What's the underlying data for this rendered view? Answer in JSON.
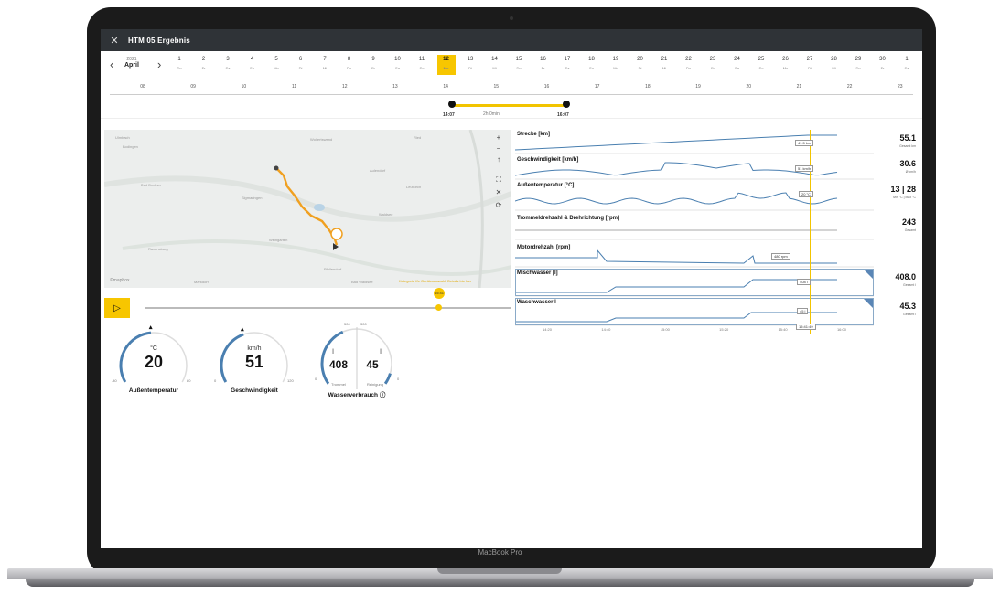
{
  "window": {
    "title": "HTM 05 Ergebnis"
  },
  "calendar": {
    "year": "2021",
    "month": "April",
    "days": [
      {
        "num": "1",
        "wd": "Do"
      },
      {
        "num": "2",
        "wd": "Fr"
      },
      {
        "num": "3",
        "wd": "Sa"
      },
      {
        "num": "4",
        "wd": "So"
      },
      {
        "num": "5",
        "wd": "Mo"
      },
      {
        "num": "6",
        "wd": "Di"
      },
      {
        "num": "7",
        "wd": "Mi"
      },
      {
        "num": "8",
        "wd": "Do"
      },
      {
        "num": "9",
        "wd": "Fr"
      },
      {
        "num": "10",
        "wd": "Sa"
      },
      {
        "num": "11",
        "wd": "So"
      },
      {
        "num": "12",
        "wd": "Mo"
      },
      {
        "num": "13",
        "wd": "Di"
      },
      {
        "num": "14",
        "wd": "Mi"
      },
      {
        "num": "15",
        "wd": "Do"
      },
      {
        "num": "16",
        "wd": "Fr"
      },
      {
        "num": "17",
        "wd": "Sa"
      },
      {
        "num": "18",
        "wd": "So"
      },
      {
        "num": "19",
        "wd": "Mo"
      },
      {
        "num": "20",
        "wd": "Di"
      },
      {
        "num": "21",
        "wd": "Mi"
      },
      {
        "num": "22",
        "wd": "Do"
      },
      {
        "num": "23",
        "wd": "Fr"
      },
      {
        "num": "24",
        "wd": "Sa"
      },
      {
        "num": "25",
        "wd": "So"
      },
      {
        "num": "26",
        "wd": "Mo"
      },
      {
        "num": "27",
        "wd": "Di"
      },
      {
        "num": "28",
        "wd": "Mi"
      },
      {
        "num": "29",
        "wd": "Do"
      },
      {
        "num": "30",
        "wd": "Fr"
      },
      {
        "num": "1",
        "wd": "Sa"
      }
    ],
    "active_index": 11
  },
  "timeline": {
    "ticks": [
      "08",
      "09",
      "10",
      "11",
      "12",
      "13",
      "14",
      "15",
      "16",
      "17",
      "18",
      "19",
      "20",
      "21",
      "22",
      "23"
    ],
    "start": "14:07",
    "end": "16:07",
    "duration": "2h 0min"
  },
  "map": {
    "places": [
      "Ulmbach",
      "Bodingen",
      "Wolfertswend",
      "Ried",
      "Bad Buchau",
      "Sigmaringen",
      "Leutkirch",
      "Aulendorf",
      "Waldsee",
      "Ravensburg",
      "Weingarten",
      "Markdorf",
      "Pfullendorf",
      "Bad Waldsee"
    ],
    "attribution": "©mapbox",
    "note": "Kategorie für Geräteauswahl: Details bis hier",
    "controls": [
      "+",
      "−",
      "↑"
    ]
  },
  "playback": {
    "play_symbol": "▷",
    "time_marker": "15:41"
  },
  "gauges": {
    "temperature": {
      "unit": "°C",
      "value": "20",
      "label": "Außentemperatur",
      "min": "-40",
      "max": "80",
      "fraction": 0.48
    },
    "speed": {
      "unit": "km/h",
      "value": "51",
      "label": "Geschwindigkeit",
      "min": "0",
      "max": "120",
      "fraction": 0.42
    },
    "water": {
      "label": "Wasserverbrauch",
      "left": {
        "unit": "l",
        "value": "408",
        "sub": "Trommel",
        "scale": "500",
        "min": "0",
        "fraction": 0.81
      },
      "right": {
        "unit": "l",
        "value": "45",
        "sub": "Reinigung",
        "scale": "300",
        "min": "0",
        "fraction": 0.15
      }
    }
  },
  "charts": {
    "rows": [
      {
        "title": "Strecke [km]",
        "value": "55.1",
        "sub": "Gesamt km",
        "box": "41.5 km"
      },
      {
        "title": "Geschwindigkeit [km/h]",
        "value": "30.6",
        "sub": "Ø km/h",
        "box": "51 km/h"
      },
      {
        "title": "Außentemperatur [°C]",
        "value": "13 | 28",
        "sub": "Min °C | Max °C",
        "box": "20 °C"
      },
      {
        "title": "Trommeldrehzahl & Drehrichtung [rpm]",
        "value": "243",
        "sub": "Gesamt",
        "box": ""
      },
      {
        "title": "Motordrehzahl [rpm]",
        "value": "",
        "sub": "",
        "box": "480 rpm"
      },
      {
        "title": "Mischwasser [l]",
        "value": "408.0",
        "sub": "Gesamt l",
        "box": "408 l"
      },
      {
        "title": "Waschwasser l",
        "value": "45.3",
        "sub": "Gesamt l",
        "box": "45 l"
      }
    ],
    "x_ticks": [
      "14:20",
      "14:40",
      "15:00",
      "15:20",
      "15:40",
      "16:00"
    ],
    "cursor_time": "15:41:49"
  },
  "colors": {
    "accent": "#f7c600",
    "gauge_arc": "#4a7fb0",
    "route": "#f0a020"
  },
  "device": {
    "label": "MacBook Pro"
  }
}
